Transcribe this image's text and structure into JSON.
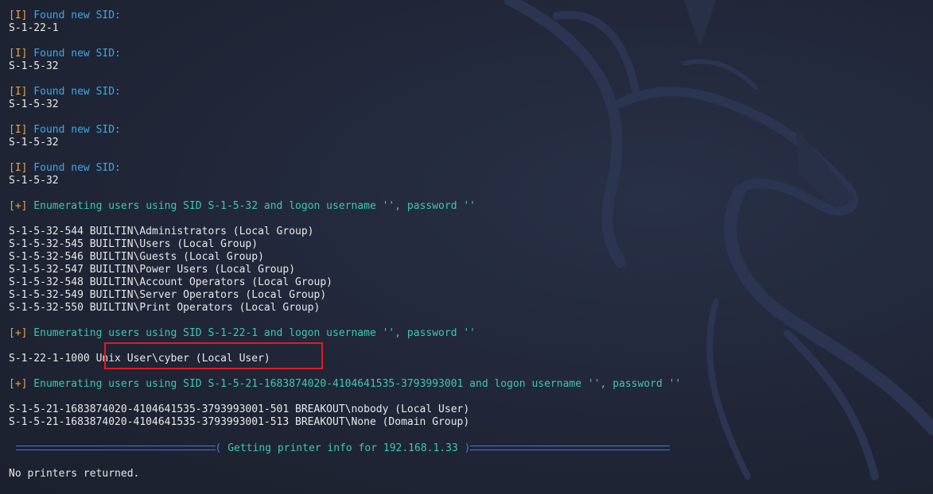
{
  "terminal": {
    "lines": [
      {
        "kind": "info",
        "tag": "[I]",
        "text": " Found new SID:"
      },
      {
        "kind": "plain",
        "text": "S-1-22-1"
      },
      {
        "kind": "blank",
        "text": ""
      },
      {
        "kind": "info",
        "tag": "[I]",
        "text": " Found new SID:"
      },
      {
        "kind": "plain",
        "text": "S-1-5-32"
      },
      {
        "kind": "blank",
        "text": ""
      },
      {
        "kind": "info",
        "tag": "[I]",
        "text": " Found new SID:"
      },
      {
        "kind": "plain",
        "text": "S-1-5-32"
      },
      {
        "kind": "blank",
        "text": ""
      },
      {
        "kind": "info",
        "tag": "[I]",
        "text": " Found new SID:"
      },
      {
        "kind": "plain",
        "text": "S-1-5-32"
      },
      {
        "kind": "blank",
        "text": ""
      },
      {
        "kind": "info",
        "tag": "[I]",
        "text": " Found new SID:"
      },
      {
        "kind": "plain",
        "text": "S-1-5-32"
      },
      {
        "kind": "blank",
        "text": ""
      },
      {
        "kind": "enum",
        "tag": "[+]",
        "text": " Enumerating users using SID S-1-5-32 and logon username '', password ''"
      },
      {
        "kind": "blank",
        "text": ""
      },
      {
        "kind": "plain",
        "text": "S-1-5-32-544 BUILTIN\\Administrators (Local Group)"
      },
      {
        "kind": "plain",
        "text": "S-1-5-32-545 BUILTIN\\Users (Local Group)"
      },
      {
        "kind": "plain",
        "text": "S-1-5-32-546 BUILTIN\\Guests (Local Group)"
      },
      {
        "kind": "plain",
        "text": "S-1-5-32-547 BUILTIN\\Power Users (Local Group)"
      },
      {
        "kind": "plain",
        "text": "S-1-5-32-548 BUILTIN\\Account Operators (Local Group)"
      },
      {
        "kind": "plain",
        "text": "S-1-5-32-549 BUILTIN\\Server Operators (Local Group)"
      },
      {
        "kind": "plain",
        "text": "S-1-5-32-550 BUILTIN\\Print Operators (Local Group)"
      },
      {
        "kind": "blank",
        "text": ""
      },
      {
        "kind": "enum",
        "tag": "[+]",
        "text": " Enumerating users using SID S-1-22-1 and logon username '', password ''"
      },
      {
        "kind": "blank",
        "text": ""
      },
      {
        "kind": "plain",
        "text": "S-1-22-1-1000 Unix User\\cyber (Local User)"
      },
      {
        "kind": "blank",
        "text": ""
      },
      {
        "kind": "enum",
        "tag": "[+]",
        "text": " Enumerating users using SID S-1-5-21-1683874020-4104641535-3793993001 and logon username '', password ''"
      },
      {
        "kind": "blank",
        "text": ""
      },
      {
        "kind": "plain",
        "text": "S-1-5-21-1683874020-4104641535-3793993001-501 BREAKOUT\\nobody (Local User)"
      },
      {
        "kind": "plain",
        "text": "S-1-5-21-1683874020-4104641535-3793993001-513 BREAKOUT\\None (Domain Group)"
      }
    ],
    "banner": {
      "open": "( ",
      "text": "Getting printer info for 192.168.1.33",
      "close": " )"
    },
    "footer": "No printers returned."
  },
  "colors": {
    "background": "#1f2433",
    "text": "#e8e8ea",
    "tag": "#e8a34a",
    "info": "#3fa7e6",
    "enum": "#3fc6b2",
    "rule": "#3b7be0",
    "highlight": "#e11a22"
  }
}
